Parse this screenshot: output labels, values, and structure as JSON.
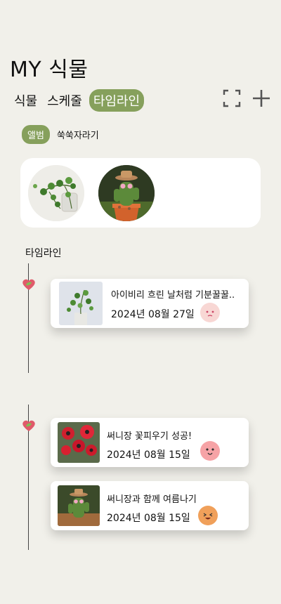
{
  "header": {
    "title": "MY 식물"
  },
  "tabs": [
    {
      "label": "식물",
      "active": false
    },
    {
      "label": "스케줄",
      "active": false
    },
    {
      "label": "타임라인",
      "active": true
    }
  ],
  "toolbar": {
    "expand_icon": "expand-icon",
    "add_icon": "plus-icon"
  },
  "filter": {
    "album_label": "앨범",
    "plant_name": "쑥쑥자라기"
  },
  "album": {
    "photos": [
      "ivy-plant-photo",
      "cactus-with-hat-photo"
    ]
  },
  "timeline": {
    "label": "타임라인",
    "entries": [
      {
        "title": "아이비리 흐린 날처럼 기분꿀꿀..",
        "date": "2024년 08월 27일",
        "mood": "sad-face"
      },
      {
        "title": "써니장 꽃피우기 성공!",
        "date": "2024년 08월 15일",
        "mood": "love-face"
      },
      {
        "title": "써니장과 함께 여름나기",
        "date": "2024년 08월 15일",
        "mood": "happy-face"
      }
    ]
  },
  "colors": {
    "accent": "#86a05c",
    "background": "#f1f0ea",
    "leaf_marker": "#e05a6a"
  }
}
